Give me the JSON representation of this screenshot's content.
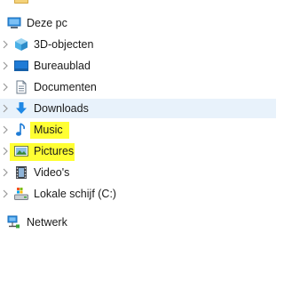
{
  "tree": {
    "this_pc": {
      "label": "Deze pc",
      "icon": "computer-icon"
    },
    "items": [
      {
        "label": "3D-objecten",
        "icon": "3d-objects-icon"
      },
      {
        "label": "Bureaublad",
        "icon": "desktop-icon"
      },
      {
        "label": "Documenten",
        "icon": "documents-icon"
      },
      {
        "label": "Downloads",
        "icon": "downloads-icon",
        "hovered": true
      },
      {
        "label": "Music",
        "icon": "music-icon",
        "highlight": "#ffff33"
      },
      {
        "label": "Pictures",
        "icon": "pictures-icon",
        "highlight": "#ffff33"
      },
      {
        "label": "Video's",
        "icon": "videos-icon"
      },
      {
        "label": "Lokale schijf (C:)",
        "icon": "local-disk-icon"
      }
    ],
    "network": {
      "label": "Netwerk",
      "icon": "network-icon"
    }
  },
  "colors": {
    "hover_background": "#e8f2fb",
    "marker_highlight": "#ffff33",
    "accent_blue": "#1e7bd6"
  }
}
